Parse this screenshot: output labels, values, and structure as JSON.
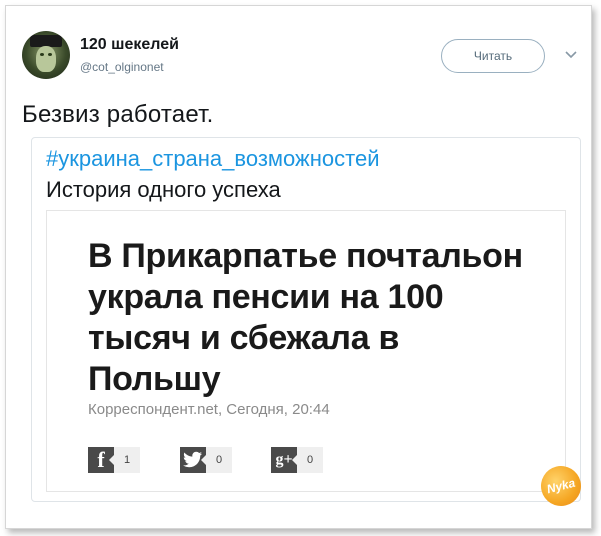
{
  "user": {
    "display_name": "120 шекелей",
    "handle": "@cot_olginonet"
  },
  "follow_button": {
    "label": "Читать"
  },
  "tweet": {
    "text": "Безвиз работает."
  },
  "quoted": {
    "hashtag": "#украина_страна_возможностей",
    "text": "История одного успеха"
  },
  "article": {
    "headline": "В Прикарпатье почтальон украла пенсии на 100 тысяч и сбежала в Польшу",
    "source_line": "Корреспондент.net, Сегодня, 20:44"
  },
  "share": {
    "facebook": {
      "icon": "facebook-icon",
      "glyph": "f",
      "count": "1"
    },
    "twitter": {
      "icon": "twitter-bird-icon",
      "glyph": "t",
      "count": "0"
    },
    "googleplus": {
      "icon": "google-plus-icon",
      "glyph": "g+",
      "count": "0"
    }
  },
  "watermark": {
    "text": "Nyka"
  },
  "colors": {
    "hashtag": "#1b95e0",
    "text": "#14171a",
    "muted": "#657786"
  }
}
